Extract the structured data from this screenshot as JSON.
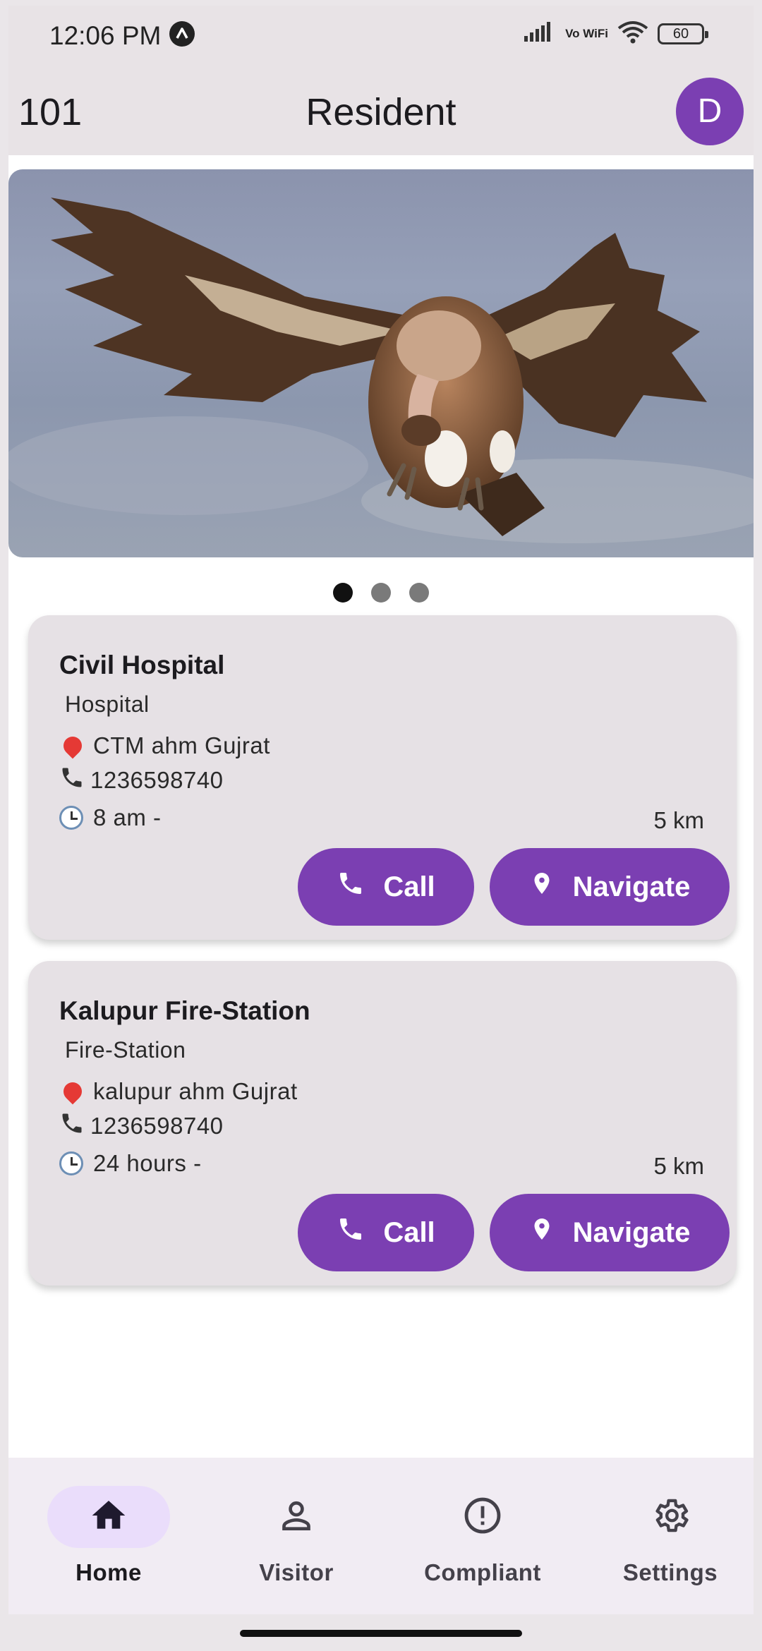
{
  "status_bar": {
    "time": "12:06 PM",
    "network_label": "Vo WiFi",
    "battery": "60"
  },
  "app_bar": {
    "flat_number": "101",
    "title": "Resident",
    "avatar_initial": "D"
  },
  "banner": {
    "image": "vulture-flying-photo",
    "page_count": 3,
    "active_page": 1
  },
  "cards": [
    {
      "name": "Civil Hospital",
      "type": "Hospital",
      "address": "CTM ahm Gujrat",
      "phone": "1236598740",
      "hours": "8 am -",
      "distance": "5 km",
      "call_label": "Call",
      "navigate_label": "Navigate"
    },
    {
      "name": "Kalupur Fire-Station",
      "type": "Fire-Station",
      "address": "kalupur ahm Gujrat",
      "phone": "1236598740",
      "hours": "24 hours -",
      "distance": "5 km",
      "call_label": "Call",
      "navigate_label": "Navigate"
    }
  ],
  "bottom_nav": {
    "items": [
      {
        "label": "Home",
        "icon": "home-icon",
        "active": true
      },
      {
        "label": "Visitor",
        "icon": "person-icon",
        "active": false
      },
      {
        "label": "Compliant",
        "icon": "alert-circle-icon",
        "active": false
      },
      {
        "label": "Settings",
        "icon": "gear-icon",
        "active": false
      }
    ]
  },
  "colors": {
    "primary": "#7b3fb2",
    "bar_background": "#e8e3e6",
    "card_background": "#e6e1e5",
    "nav_active_pill": "#eaddfb"
  }
}
